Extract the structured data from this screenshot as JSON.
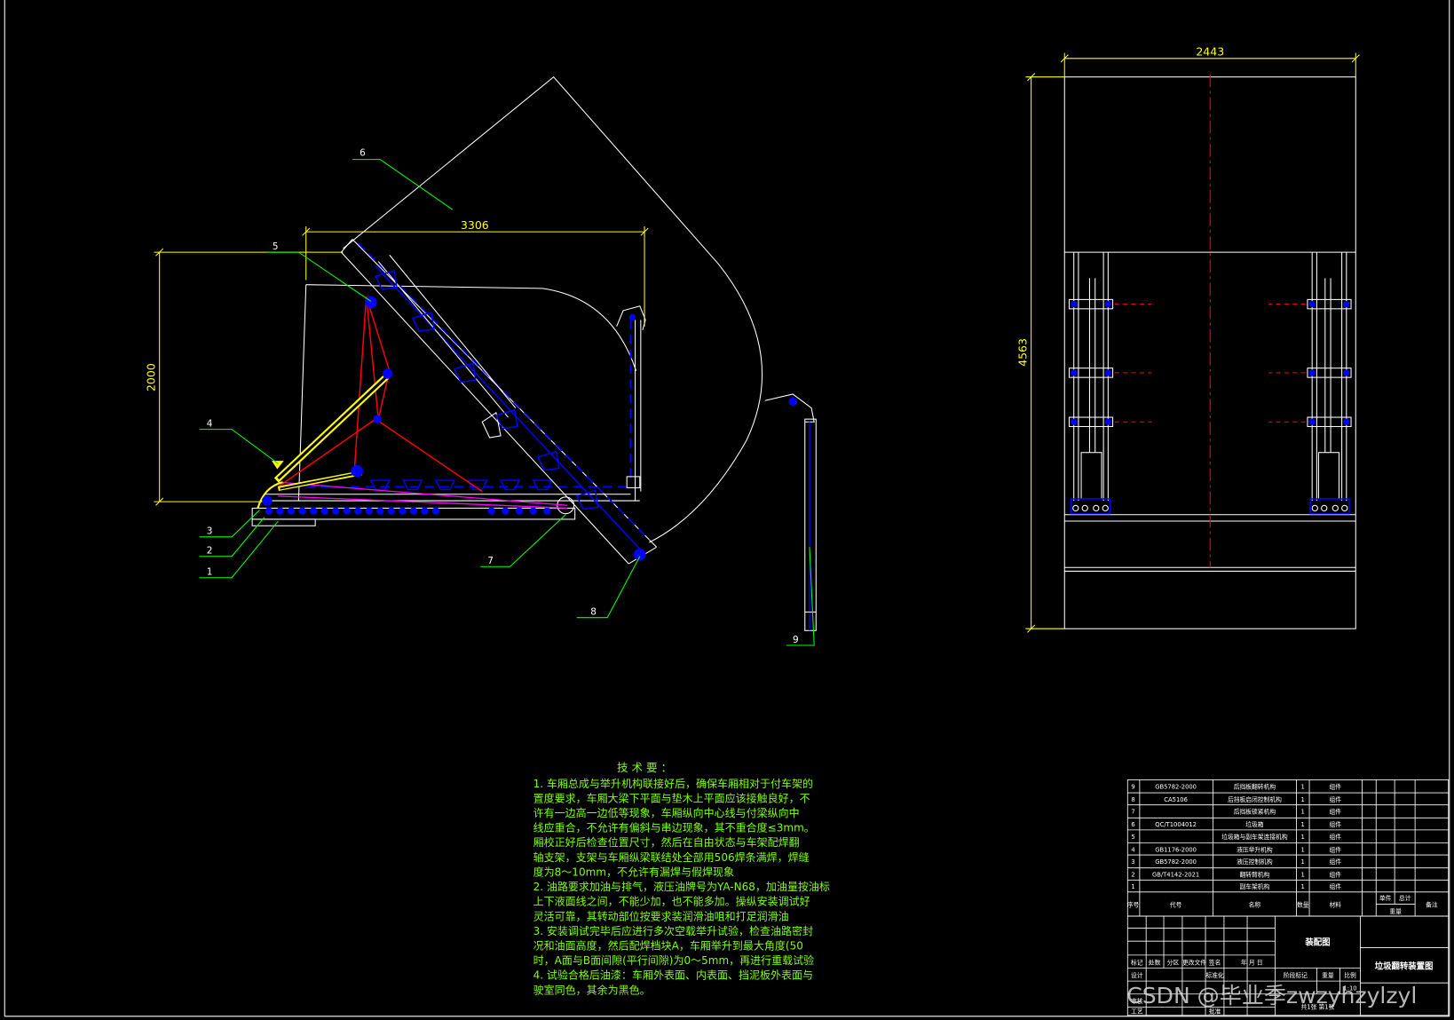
{
  "colors": {
    "background": "#000000",
    "outline": "#ffffff",
    "dimension": "#ffff00",
    "leader": "#00ff00",
    "note_text": "#7fff00",
    "centerline": "#ff0000",
    "hidden_line": "#0000ff",
    "mechanism_red": "#ff0000",
    "mechanism_magenta": "#ff00ff",
    "cylinder": "#ffff00",
    "watermark": "#d8d8d8"
  },
  "dimensions": {
    "side_width": "3306",
    "side_height": "2000",
    "front_width": "2443",
    "front_height": "4563"
  },
  "balloons": [
    "1",
    "2",
    "3",
    "4",
    "5",
    "6",
    "7",
    "8",
    "9"
  ],
  "tech_requirements": {
    "title": "技 术 要 ：",
    "lines": [
      "1. 车厢总成与举升机构联接好后，确保车厢相对于付车架的",
      "置度要求，车厢大梁下平面与垫木上平面应该接触良好，不",
      "许有一边高一边低等现象，车厢纵向中心线与付梁纵向中",
      "线应重合，不允许有偏斜与串边现象，其不重合度≤3mm。",
      "厢校正好后检查位置尺寸，然后在自由状态与车架配焊翻",
      "轴支架，支架与车厢纵梁联结处全部用506焊条满焊，焊缝",
      "度为8～10mm，不允许有漏焊与假焊现象",
      "2. 油路要求加油与排气，液压油牌号为YA-N68，加油量按油标",
      "上下液面线之间，不能少加，也不能多加。操纵安装调试好",
      "灵活可靠，其转动部位按要求装润滑油咀和打足润滑油",
      "3. 安装调试完毕后应进行多次空载举升试验，检查油路密封",
      "况和油面高度，然后配焊档块A，车厢举升到最大角度(50",
      "时，A面与B面间隙(平行间隙)为0～5mm，再进行重载试验",
      "4. 试验合格后油漆：车厢外表面、内表面、挡泥板外表面与",
      "驶室同色，其余为黑色。"
    ]
  },
  "parts_list": {
    "header": {
      "no": "序号",
      "code": "代号",
      "name": "名称",
      "qty": "数量",
      "material": "材料",
      "unit": "单件",
      "total": "总计",
      "weight": "重量",
      "remark": "备注"
    },
    "rows": [
      {
        "no": "9",
        "code": "GB5782-2000",
        "name": "后挡板翻转机构",
        "qty": "1",
        "material": "组件"
      },
      {
        "no": "8",
        "code": "CA5106",
        "name": "后挡板启闭控制机构",
        "qty": "1",
        "material": "组件"
      },
      {
        "no": "7",
        "code": "",
        "name": "后挡板锁紧机构",
        "qty": "1",
        "material": "组件"
      },
      {
        "no": "6",
        "code": "QC/T1004012",
        "name": "垃圾箱",
        "qty": "1",
        "material": "组件"
      },
      {
        "no": "5",
        "code": "",
        "name": "垃圾箱与副车架连接机构",
        "qty": "1",
        "material": "组件"
      },
      {
        "no": "4",
        "code": "GB1176-2000",
        "name": "液压举升机构",
        "qty": "1",
        "material": "组件"
      },
      {
        "no": "3",
        "code": "GB5782-2000",
        "name": "液压控制机构",
        "qty": "1",
        "material": "组件"
      },
      {
        "no": "2",
        "code": "GB/T4142-2021",
        "name": "翻转臂机构",
        "qty": "1",
        "material": "组件"
      },
      {
        "no": "1",
        "code": "",
        "name": "副车架机构",
        "qty": "1",
        "material": "组件"
      }
    ]
  },
  "title_block": {
    "drawing_type": "装配图",
    "drawing_name": "垃圾翻转装置图",
    "labels": {
      "mark": "标记",
      "count": "处数",
      "zone": "分区",
      "change_doc": "更改文件",
      "signature": "签名",
      "date": "年 月 日",
      "design": "设计",
      "standardization": "标准化",
      "stage_mark": "阶段标记",
      "weight": "重量",
      "scale": "比例",
      "review": "审核",
      "process": "工艺",
      "approve": "批准"
    },
    "scale_value": "1:10",
    "sheets": "共1张 第1张"
  },
  "watermark": "CSDN @毕业季zwzyhzylzyl"
}
